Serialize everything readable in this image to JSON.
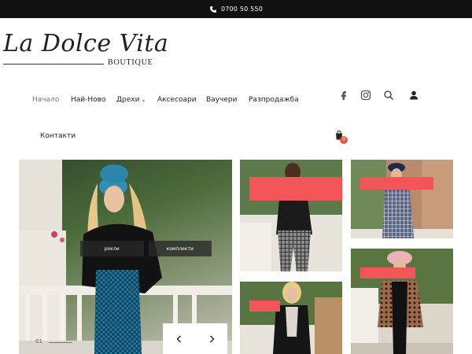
{
  "topbar": {
    "phone": "0700 50 550",
    "icon": "phone-icon"
  },
  "logo": {
    "script": "La Dolce Vita",
    "sub": "BOUTIQUE"
  },
  "nav": {
    "items": [
      {
        "label": "Начало",
        "active": true
      },
      {
        "label": "Най-Ново"
      },
      {
        "label": "Дрехи",
        "has_dropdown": true
      },
      {
        "label": "Аксесоари"
      },
      {
        "label": "Ваучери"
      },
      {
        "label": "Разпродажба"
      },
      {
        "label": "Контакти"
      }
    ],
    "icons": [
      "facebook-icon",
      "instagram-icon",
      "search-icon",
      "user-icon",
      "cart-icon"
    ],
    "cart_count": "0"
  },
  "hero": {
    "tabs": [
      "рокли",
      "комплекти"
    ],
    "slide_number": "01",
    "prev_icon": "chevron-left-icon",
    "next_icon": "chevron-right-icon"
  },
  "colors": {
    "topbar": "#111111",
    "badge": "#e9573f",
    "redaction": "#f25557"
  }
}
